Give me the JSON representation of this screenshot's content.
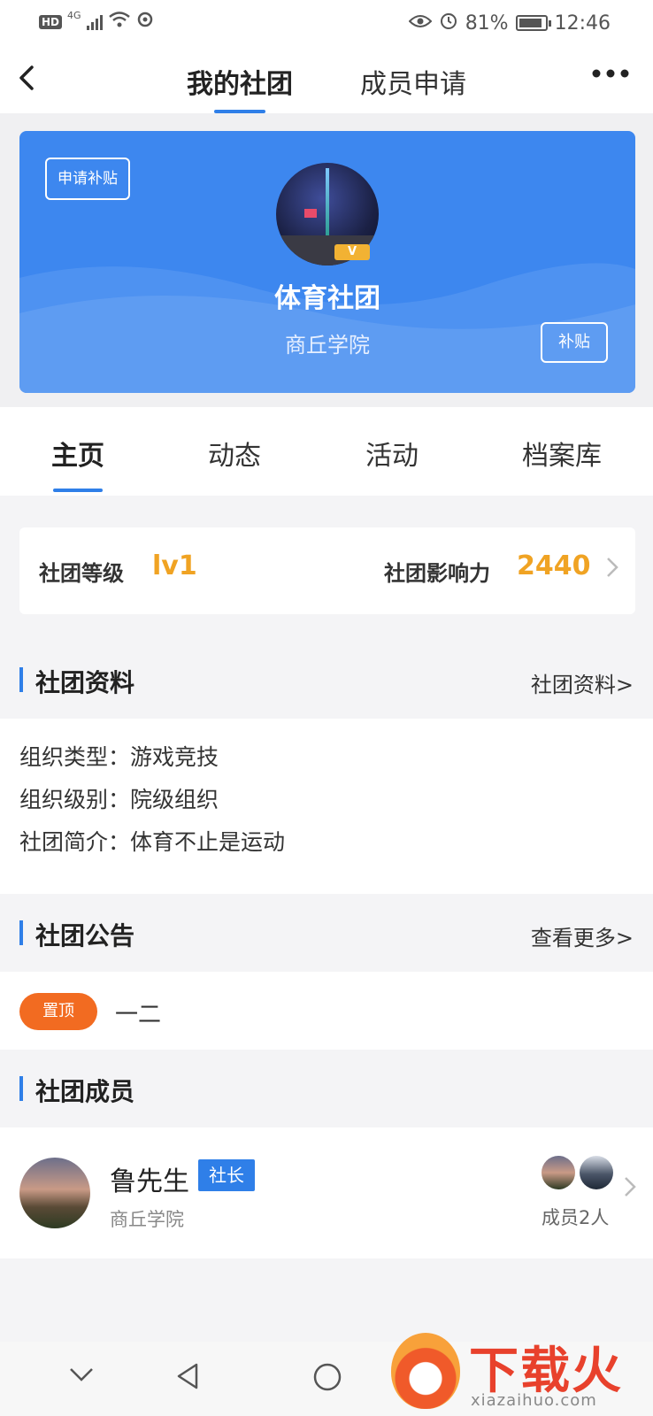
{
  "status_bar": {
    "hd": "HD",
    "signal": "4G",
    "battery": "81%",
    "time": "12:46"
  },
  "nav": {
    "back_icon": "chevron-left-icon",
    "tabs": [
      "我的社团",
      "成员申请"
    ],
    "active_tab": 0,
    "more_icon": "more-dots-icon"
  },
  "banner": {
    "apply_button": "申请补贴",
    "vip_badge": "V",
    "club_name": "体育社团",
    "school": "商丘学院",
    "subsidy_button": "补贴",
    "color": "#3d87ef"
  },
  "tabs": [
    "主页",
    "动态",
    "活动",
    "档案库"
  ],
  "active_tab": 0,
  "level": {
    "level_label": "社团等级",
    "level_value": "lv1",
    "influence_label": "社团影响力",
    "influence_value": "2440"
  },
  "profile_section": {
    "title": "社团资料",
    "link": "社团资料>",
    "rows": [
      "组织类型：游戏竞技",
      "组织级别：院级组织",
      "社团简介：体育不止是运动"
    ]
  },
  "notice_section": {
    "title": "社团公告",
    "link": "查看更多>",
    "pin_label": "置顶",
    "notice_text": "一二"
  },
  "member_section": {
    "title": "社团成员",
    "name": "鲁先生",
    "role": "社长",
    "school": "商丘学院",
    "member_count": "成员2人"
  },
  "watermark": {
    "text": "下载火",
    "sub": "xiazaihuo.com"
  },
  "colors": {
    "accent": "#2f7fe8",
    "highlight": "#f0a323",
    "pin": "#f26b21"
  }
}
